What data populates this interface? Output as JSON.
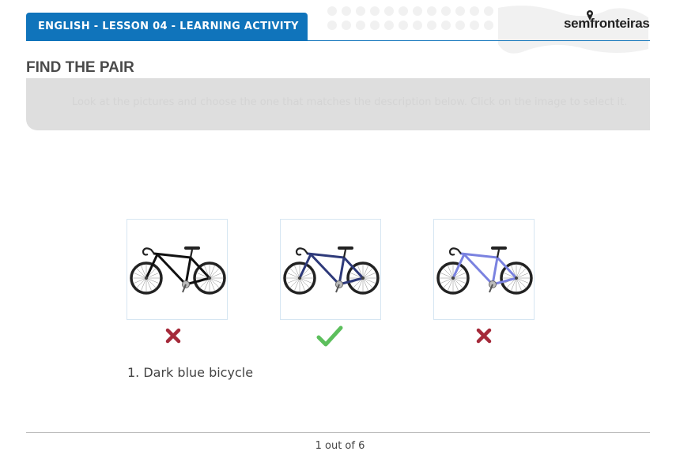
{
  "header": {
    "lesson_title": "ENGLISH - LESSON 04 - LEARNING ACTIVITY",
    "logo_text": "semfronteiras"
  },
  "activity": {
    "title": "FIND THE PAIR",
    "instruction": "Look at the pictures and choose the one that matches the description below. Click on the image to select it."
  },
  "options": [
    {
      "icon": "bicycle-icon",
      "frame_color": "#111111",
      "result": "incorrect"
    },
    {
      "icon": "bicycle-icon",
      "frame_color": "#2e3a7a",
      "result": "correct"
    },
    {
      "icon": "bicycle-icon",
      "frame_color": "#7a82e0",
      "result": "incorrect"
    }
  ],
  "marks": {
    "incorrect_icon": "cross-icon",
    "correct_icon": "checkmark-icon",
    "incorrect_color": "#a52a3a",
    "correct_color": "#5cbf5c"
  },
  "question": {
    "prompt": "1. Dark blue bicycle"
  },
  "pagination": {
    "label": "1 out of 6"
  },
  "colors": {
    "accent": "#1074bb",
    "panel": "#dedede"
  }
}
